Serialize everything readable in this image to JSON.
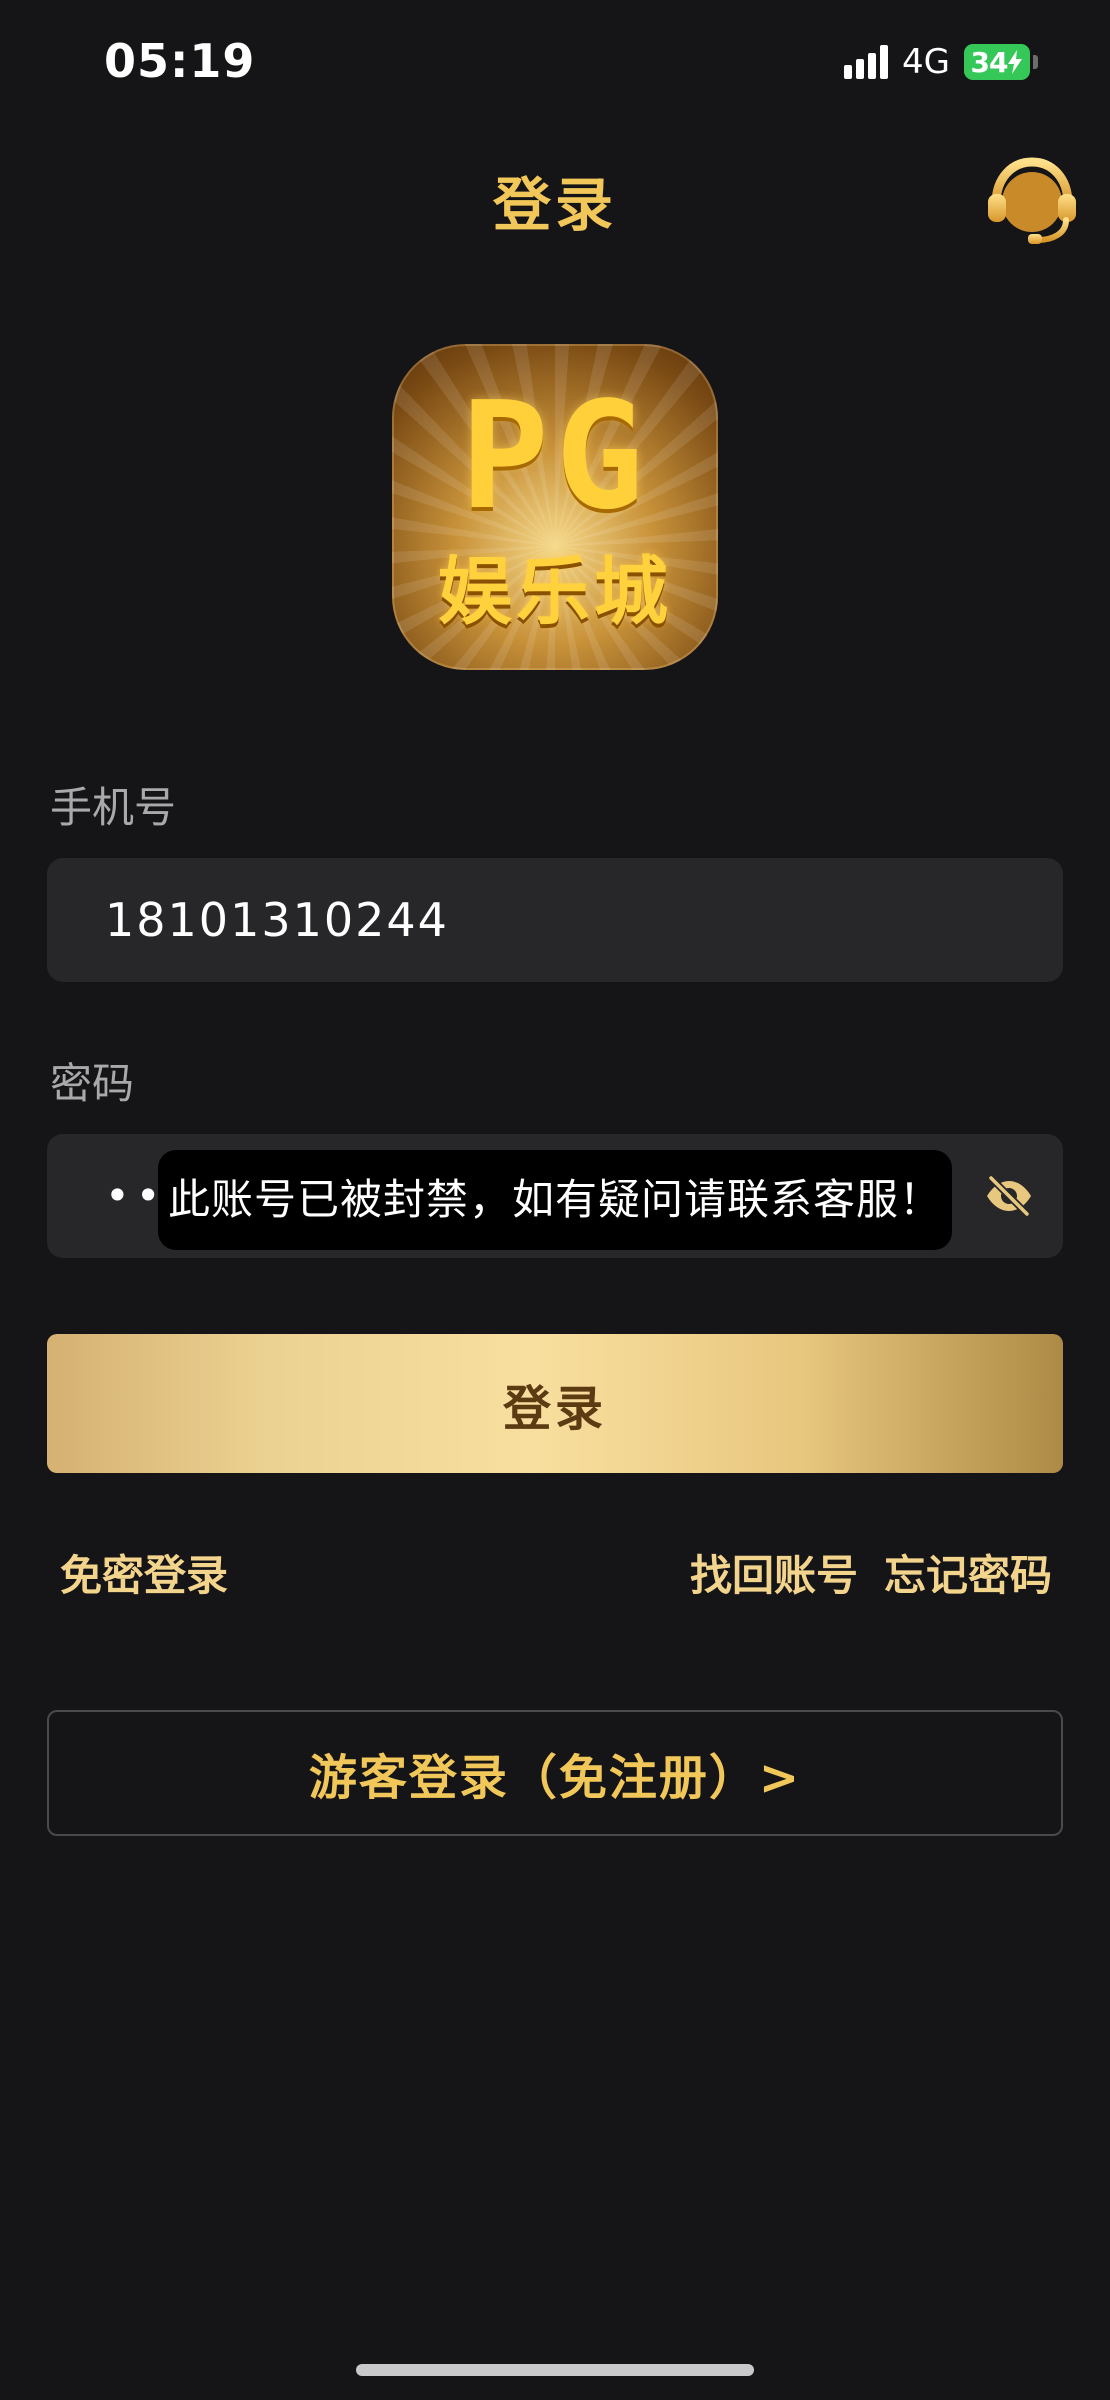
{
  "status_bar": {
    "time": "05:19",
    "network": "4G",
    "battery": "34",
    "battery_color": "#36c759"
  },
  "header": {
    "title": "登录",
    "support_icon": "headset-icon"
  },
  "logo": {
    "letters": "PG",
    "name": "娱乐城"
  },
  "form": {
    "phone_label": "手机号",
    "phone_value": "18101310244",
    "password_label": "密码",
    "password_value": "•••",
    "password_toggle_icon": "eye-off-icon"
  },
  "toast": {
    "message": "此账号已被封禁，如有疑问请联系客服！"
  },
  "actions": {
    "login_label": "登录",
    "passwordless_login": "免密登录",
    "recover_account": "找回账号",
    "forgot_password": "忘记密码",
    "guest_login": "游客登录（免注册）>"
  },
  "colors": {
    "background": "#151417",
    "accent_gold": "#f1c75a",
    "input_bg": "#272629"
  }
}
